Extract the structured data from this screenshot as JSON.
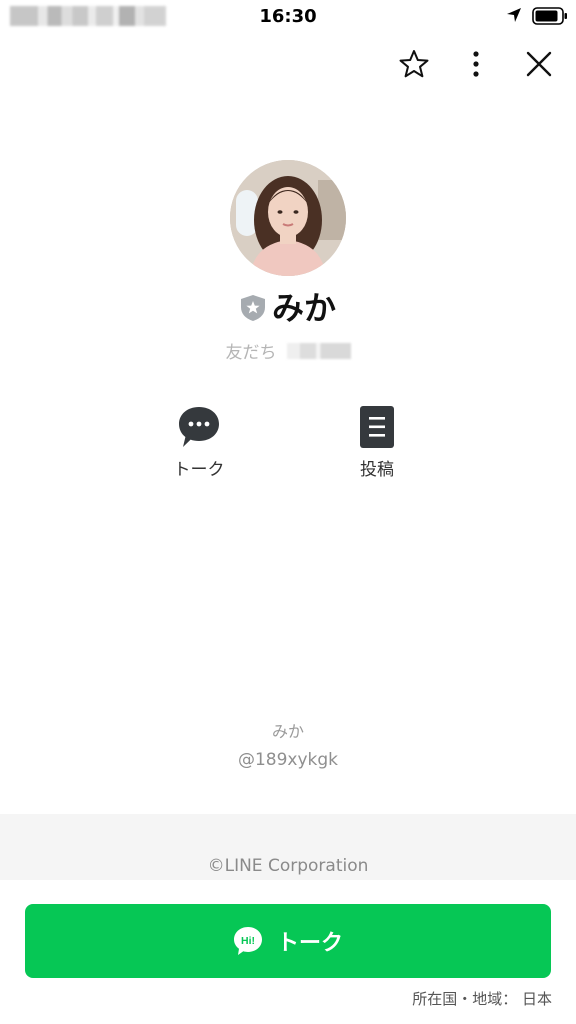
{
  "status_bar": {
    "time": "16:30"
  },
  "toolbar": {
    "favorite_icon": "star-icon",
    "menu_icon": "more-vertical-icon",
    "close_icon": "close-icon"
  },
  "profile": {
    "name": "みか",
    "badge_icon": "shield-star-icon",
    "friend_label": "友だち"
  },
  "quick_actions": [
    {
      "label": "トーク",
      "icon": "chat-bubble-icon"
    },
    {
      "label": "投稿",
      "icon": "document-icon"
    }
  ],
  "footer_info": {
    "name": "みか",
    "line_id": "@189xykgk"
  },
  "copyright": "©LINE Corporation",
  "cta": {
    "label": "トーク",
    "icon": "hi-bubble-icon",
    "color": "#06C755"
  },
  "region": {
    "label": "所在国・地域：",
    "value": "日本"
  }
}
